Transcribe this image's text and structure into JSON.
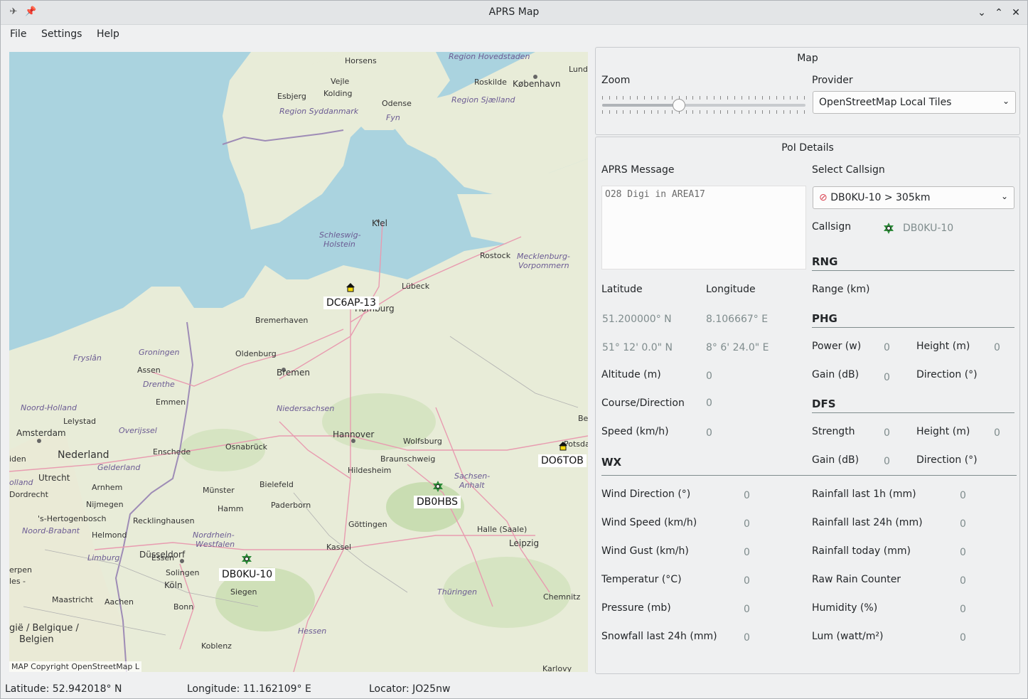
{
  "window": {
    "title": "APRS Map"
  },
  "menu": {
    "file": "File",
    "settings": "Settings",
    "help": "Help"
  },
  "map": {
    "copyright": "MAP Copyright OpenStreetMap L",
    "stations": [
      {
        "callsign": "DC6AP-13",
        "icon": "house-icon"
      },
      {
        "callsign": "DO6TOB",
        "icon": "house-icon"
      },
      {
        "callsign": "DB0HBS",
        "icon": "digipeater-icon"
      },
      {
        "callsign": "DB0KU-10",
        "icon": "digipeater-icon"
      }
    ],
    "labels": {
      "horsens": "Horsens",
      "vejle": "Vejle",
      "kolding": "Kolding",
      "esbjerg": "Esbjerg",
      "region_hovedstaden": "Region Hovedstaden",
      "lund": "Lund",
      "roskilde": "Roskilde",
      "kobenhavn": "København",
      "region_syddanmark": "Region Syddanmark",
      "odense": "Odense",
      "fyn": "Fyn",
      "region_sjaelland": "Region Sjælland",
      "kiel": "Kiel",
      "schleswig": "Schleswig-",
      "holstein": "Holstein",
      "rostock": "Rostock",
      "mecklenburg": "Mecklenburg-",
      "vorpommern": "Vorpommern",
      "lubeck": "Lübeck",
      "hamburg": "Hamburg",
      "bremerhaven": "Bremerhaven",
      "groningen": "Groningen",
      "fryslan": "Fryslân",
      "assen": "Assen",
      "drenthe": "Drenthe",
      "oldenburg": "Oldenburg",
      "bremen": "Bremen",
      "emmen": "Emmen",
      "noord_holland": "Noord-Holland",
      "lelystad": "Lelystad",
      "overijssel": "Overijssel",
      "niedersachsen": "Niedersachsen",
      "amsterdam": "Amsterdam",
      "nederland": "Nederland",
      "enschede": "Enschede",
      "osnabruck": "Osnabrück",
      "hannover": "Hannover",
      "wolfsburg": "Wolfsburg",
      "braunschweig": "Braunschweig",
      "hildesheim": "Hildesheim",
      "sachsen": "Sachsen-",
      "anhalt": "Anhalt",
      "utrecht": "Utrecht",
      "gelderland": "Gelderland",
      "arnhem": "Arnhem",
      "munster": "Münster",
      "bielefeld": "Bielefeld",
      "nijmegen": "Nijmegen",
      "dordrecht": "Dordrecht",
      "hamm": "Hamm",
      "paderborn": "Paderborn",
      "gottingen": "Göttingen",
      "halle": "Halle (Saale)",
      "hertogenbosch": "'s-Hertogenbosch",
      "recklinghausen": "Recklinghausen",
      "noord_brabant": "Noord-Brabant",
      "helmond": "Helmond",
      "nordrhein": "Nordrhein-",
      "westfalen": "Westfalen",
      "kassel": "Kassel",
      "leipzig": "Leipzig",
      "limburg": "Limburg",
      "essen": "Essen",
      "dusseldorf": "Düsseldorf",
      "solingen": "Solingen",
      "koln": "Köln",
      "siegen": "Siegen",
      "thuringen": "Thüringen",
      "chemnitz": "Chemnitz",
      "maastricht": "Maastricht",
      "aachen": "Aachen",
      "bonn": "Bonn",
      "hessen": "Hessen",
      "belgie": "gië / Belgique /",
      "belgien": "Belgien",
      "koblenz": "Koblenz",
      "karlovy": "Karlovy",
      "erpen": "erpen",
      "les": "les -",
      "olland": "olland",
      "iden": "iden",
      "be": "Be",
      "potsdam": "Potsdam"
    }
  },
  "map_panel": {
    "title": "Map",
    "zoom_label": "Zoom",
    "zoom_level": 0.37,
    "provider_label": "Provider",
    "provider_value": "OpenStreetMap Local Tiles"
  },
  "poi": {
    "title": "PoI Details",
    "aprs_message_label": "APRS Message",
    "aprs_message": "O28 Digi in AREA17",
    "select_callsign_label": "Select Callsign",
    "select_callsign_value": "DB0KU-10 > 305km",
    "callsign_label": "Callsign",
    "callsign_value": "DB0KU-10",
    "latitude_label": "Latitude",
    "longitude_label": "Longitude",
    "latitude_dec": "51.200000° N",
    "longitude_dec": "8.106667° E",
    "latitude_dms": "51° 12' 0.0\" N",
    "longitude_dms": "8° 6' 24.0\" E",
    "altitude_label": "Altitude (m)",
    "altitude_value": "0",
    "course_label": "Course/Direction",
    "course_value": "0",
    "speed_label": "Speed (km/h)",
    "speed_value": "0",
    "rng_title": "RNG",
    "range_label": "Range (km)",
    "phg_title": "PHG",
    "power_label": "Power (w)",
    "power_value": "0",
    "phg_height_label": "Height (m)",
    "phg_height_value": "0",
    "phg_gain_label": "Gain (dB)",
    "phg_gain_value": "0",
    "phg_direction_label": "Direction (°)",
    "dfs_title": "DFS",
    "strength_label": "Strength",
    "strength_value": "0",
    "dfs_height_label": "Height (m)",
    "dfs_height_value": "0",
    "dfs_gain_label": "Gain (dB)",
    "dfs_gain_value": "0",
    "dfs_direction_label": "Direction (°)",
    "wx_title": "WX",
    "wind_direction_label": "Wind Direction (°)",
    "wind_direction_value": "0",
    "wind_speed_label": "Wind Speed (km/h)",
    "wind_speed_value": "0",
    "wind_gust_label": "Wind Gust (km/h)",
    "wind_gust_value": "0",
    "temperature_label": "Temperatur (°C)",
    "temperature_value": "0",
    "pressure_label": "Pressure (mb)",
    "pressure_value": "0",
    "snowfall_label": "Snowfall last 24h (mm)",
    "snowfall_value": "0",
    "rain_1h_label": "Rainfall last 1h (mm)",
    "rain_1h_value": "0",
    "rain_24h_label": "Rainfall last 24h (mm)",
    "rain_24h_value": "0",
    "rain_today_label": "Rainfall today (mm)",
    "rain_today_value": "0",
    "raw_rain_label": "Raw Rain Counter",
    "raw_rain_value": "0",
    "humidity_label": "Humidity (%)",
    "humidity_value": "0",
    "lum_label": "Lum (watt/m²)",
    "lum_value": "0"
  },
  "status": {
    "latitude": "Latitude: 52.942018° N",
    "longitude": "Longitude: 11.162109° E",
    "locator": "Locator: JO25nw"
  }
}
